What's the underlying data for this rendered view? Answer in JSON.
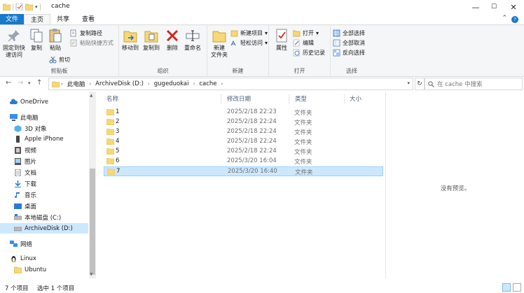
{
  "window": {
    "title": "cache"
  },
  "titlebar": {
    "minimize": "—",
    "maximize": "☐",
    "close": "✕"
  },
  "tabs": {
    "file": "文件",
    "home": "主页",
    "share": "共享",
    "view": "查看"
  },
  "ribbon": {
    "clipboard": {
      "label": "剪贴板",
      "pin_line1": "固定到快",
      "pin_line2": "速访问",
      "copy": "复制",
      "paste": "粘贴",
      "copy_path": "复制路径",
      "paste_shortcut": "粘贴快捷方式",
      "cut": "剪切"
    },
    "organize": {
      "label": "组织",
      "move_to": "移动到",
      "copy_to": "复制到",
      "delete": "删除",
      "rename": "重命名"
    },
    "new": {
      "label": "新建",
      "new_folder_line1": "新建",
      "new_folder_line2": "文件夹",
      "new_item": "新建项目",
      "easy_access": "轻松访问"
    },
    "open": {
      "label": "打开",
      "properties": "属性",
      "open": "打开",
      "edit": "编辑",
      "history": "历史记录"
    },
    "select": {
      "label": "选择",
      "select_all": "全部选择",
      "select_none": "全部取消",
      "invert": "反向选择"
    }
  },
  "address": {
    "crumbs": [
      "此电脑",
      "ArchiveDisk (D:)",
      "gugeduokai",
      "cache"
    ],
    "search_placeholder": "在 cache 中搜索"
  },
  "nav": {
    "items": [
      {
        "label": "OneDrive",
        "icon": "cloud-icon"
      },
      {
        "label": "此电脑",
        "icon": "computer-icon"
      },
      {
        "label": "3D 对象",
        "icon": "3d-objects-icon"
      },
      {
        "label": "Apple iPhone",
        "icon": "phone-icon"
      },
      {
        "label": "视频",
        "icon": "video-icon"
      },
      {
        "label": "图片",
        "icon": "pictures-icon"
      },
      {
        "label": "文档",
        "icon": "documents-icon"
      },
      {
        "label": "下载",
        "icon": "download-icon"
      },
      {
        "label": "音乐",
        "icon": "music-icon"
      },
      {
        "label": "桌面",
        "icon": "desktop-icon"
      },
      {
        "label": "本地磁盘 (C:)",
        "icon": "drive-icon"
      },
      {
        "label": "ArchiveDisk (D:)",
        "icon": "drive-icon"
      },
      {
        "label": "网络",
        "icon": "network-icon"
      },
      {
        "label": "Linux",
        "icon": "linux-icon"
      },
      {
        "label": "Ubuntu",
        "icon": "folder-icon"
      }
    ]
  },
  "list": {
    "columns": {
      "name": "名称",
      "date": "修改日期",
      "type": "类型",
      "size": "大小"
    },
    "rows": [
      {
        "name": "1",
        "date": "2025/2/18 22:23",
        "type": "文件夹"
      },
      {
        "name": "2",
        "date": "2025/2/18 22:24",
        "type": "文件夹"
      },
      {
        "name": "3",
        "date": "2025/2/18 22:24",
        "type": "文件夹"
      },
      {
        "name": "4",
        "date": "2025/2/18 22:24",
        "type": "文件夹"
      },
      {
        "name": "5",
        "date": "2025/2/18 22:24",
        "type": "文件夹"
      },
      {
        "name": "6",
        "date": "2025/3/20 16:04",
        "type": "文件夹"
      },
      {
        "name": "7",
        "date": "2025/3/20 16:40",
        "type": "文件夹"
      }
    ]
  },
  "preview": {
    "empty_text": "没有预览。"
  },
  "status": {
    "count": "7 个项目",
    "selection": "选中 1 个项目"
  },
  "colors": {
    "accent": "#1979ca",
    "selection": "#cce8ff",
    "folder": "#f8d775"
  }
}
